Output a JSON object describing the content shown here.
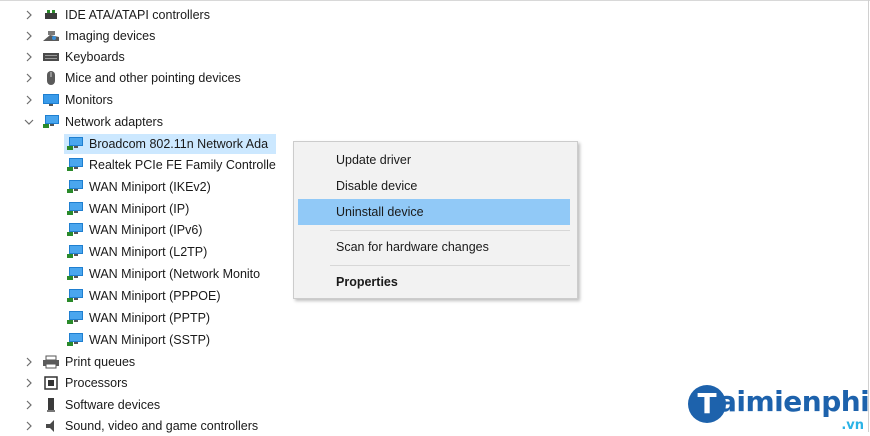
{
  "tree": {
    "categories_top": [
      {
        "label": "IDE ATA/ATAPI controllers",
        "icon": "ide-controller-icon"
      },
      {
        "label": "Imaging devices",
        "icon": "camera-icon"
      },
      {
        "label": "Keyboards",
        "icon": "keyboard-icon"
      },
      {
        "label": "Mice and other pointing devices",
        "icon": "mouse-icon"
      },
      {
        "label": "Monitors",
        "icon": "monitor-icon"
      },
      {
        "label": "Network adapters",
        "icon": "network-adapter-icon"
      }
    ],
    "network_adapters": [
      {
        "label": "Broadcom 802.11n Network Ada"
      },
      {
        "label": "Realtek PCIe FE Family Controlle"
      },
      {
        "label": "WAN Miniport (IKEv2)"
      },
      {
        "label": "WAN Miniport (IP)"
      },
      {
        "label": "WAN Miniport (IPv6)"
      },
      {
        "label": "WAN Miniport (L2TP)"
      },
      {
        "label": "WAN Miniport (Network Monito"
      },
      {
        "label": "WAN Miniport (PPPOE)"
      },
      {
        "label": "WAN Miniport (PPTP)"
      },
      {
        "label": "WAN Miniport (SSTP)"
      }
    ],
    "categories_bottom": [
      {
        "label": "Print queues",
        "icon": "printer-icon"
      },
      {
        "label": "Processors",
        "icon": "processor-icon"
      },
      {
        "label": "Software devices",
        "icon": "software-device-icon"
      },
      {
        "label": "Sound, video and game controllers",
        "icon": "speaker-icon"
      }
    ]
  },
  "context_menu": {
    "update_driver": "Update driver",
    "disable_device": "Disable device",
    "uninstall_device": "Uninstall device",
    "scan_hardware": "Scan for hardware changes",
    "properties": "Properties"
  },
  "watermark": {
    "brand": "aimienphi",
    "brand_initial": "T",
    "suffix": ".vn"
  },
  "colors": {
    "selection": "#cce8ff",
    "menu_hover": "#91c9f7",
    "menu_bg": "#f2f2f2",
    "watermark_blue": "#1d62ac"
  }
}
